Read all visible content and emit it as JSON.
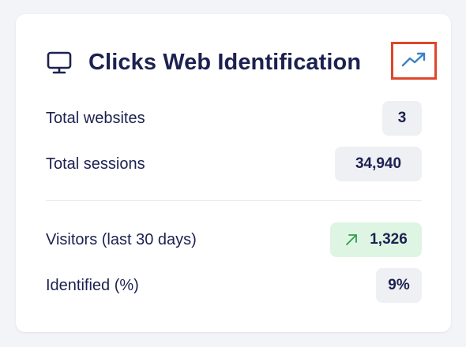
{
  "card": {
    "title": "Clicks Web Identification",
    "icon": "monitor-icon",
    "trend_button_icon": "trending-up-icon",
    "accent_color": "#3b82c4",
    "highlight_color": "#e0452a"
  },
  "stats_primary": [
    {
      "label": "Total websites",
      "value": "3"
    },
    {
      "label": "Total sessions",
      "value": "34,940"
    }
  ],
  "stats_secondary": [
    {
      "label": "Visitors (last 30 days)",
      "value": "1,326",
      "trend": "up",
      "trend_icon": "arrow-up-right-icon",
      "trend_color": "#2f9e4f"
    },
    {
      "label": "Identified (%)",
      "value": "9%"
    }
  ]
}
